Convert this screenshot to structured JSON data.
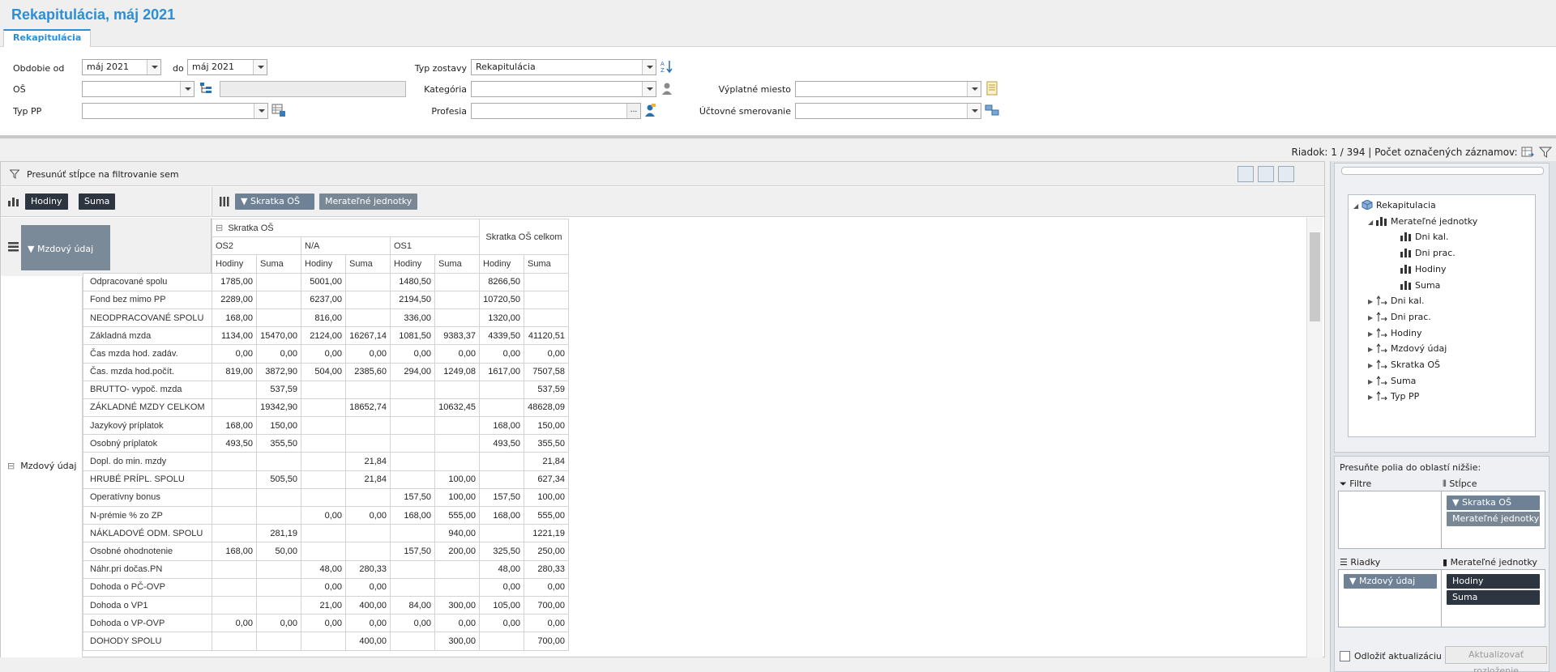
{
  "window": {
    "title": "Rekapitulácia, máj 2021",
    "tab": "Rekapitulácia"
  },
  "filters": {
    "obdobie_od_label": "Obdobie od",
    "obdobie_od_value": "máj 2021",
    "do_label": "do",
    "do_value": "máj 2021",
    "os_label": "OŠ",
    "os_value": "",
    "typpp_label": "Typ PP",
    "typpp_value": "",
    "typ_zostavy_label": "Typ zostavy",
    "typ_zostavy_value": "Rekapitulácia",
    "kategoria_label": "Kategória",
    "kategoria_value": "",
    "profesia_label": "Profesia",
    "profesia_value": "",
    "vyplatne_miesto_label": "Výplatné miesto",
    "vyplatne_miesto_value": "",
    "uctovne_label": "Účtovné smerovanie",
    "uctovne_value": ""
  },
  "status": {
    "text": "Riadok: 1 / 394 | Počet označených záznamov: 1"
  },
  "grid": {
    "filter_hint": "Presunúť stĺpce na filtrovanie sem",
    "data_chips": [
      "Hodiny",
      "Suma"
    ],
    "column_chips": [
      "Skratka OŠ",
      "Merateľné jednotky"
    ],
    "row_chip": "Mzdový údaj",
    "col_group_title": "Skratka OŠ",
    "col_groups": [
      "OS2",
      "N/A",
      "OS1"
    ],
    "total_header": "Skratka OŠ celkom",
    "measure_hodiny": "Hodiny",
    "measure_suma": "Suma",
    "row_group_label": "Mzdový údaj",
    "rows": [
      {
        "label": "Odpracované spolu",
        "v": [
          "1785,00",
          "",
          "5001,00",
          "",
          "1480,50",
          "",
          "8266,50",
          ""
        ]
      },
      {
        "label": "Fond bez mimo PP",
        "v": [
          "2289,00",
          "",
          "6237,00",
          "",
          "2194,50",
          "",
          "10720,50",
          ""
        ]
      },
      {
        "label": "NEODPRACOVANÉ SPOLU",
        "v": [
          "168,00",
          "",
          "816,00",
          "",
          "336,00",
          "",
          "1320,00",
          ""
        ]
      },
      {
        "label": "Základná mzda",
        "v": [
          "1134,00",
          "15470,00",
          "2124,00",
          "16267,14",
          "1081,50",
          "9383,37",
          "4339,50",
          "41120,51"
        ]
      },
      {
        "label": "Čas mzda hod. zadáv.",
        "v": [
          "0,00",
          "0,00",
          "0,00",
          "0,00",
          "0,00",
          "0,00",
          "0,00",
          "0,00"
        ]
      },
      {
        "label": "Čas. mzda hod.počít.",
        "v": [
          "819,00",
          "3872,90",
          "504,00",
          "2385,60",
          "294,00",
          "1249,08",
          "1617,00",
          "7507,58"
        ]
      },
      {
        "label": "BRUTTO- vypoč. mzda",
        "v": [
          "",
          "537,59",
          "",
          "",
          "",
          "",
          "",
          "537,59"
        ]
      },
      {
        "label": "ZÁKLADNÉ MZDY CELKOM",
        "v": [
          "",
          "19342,90",
          "",
          "18652,74",
          "",
          "10632,45",
          "",
          "48628,09"
        ]
      },
      {
        "label": "Jazykový príplatok",
        "v": [
          "168,00",
          "150,00",
          "",
          "",
          "",
          "",
          "168,00",
          "150,00"
        ]
      },
      {
        "label": "Osobný príplatok",
        "v": [
          "493,50",
          "355,50",
          "",
          "",
          "",
          "",
          "493,50",
          "355,50"
        ]
      },
      {
        "label": "Dopl. do min. mzdy",
        "v": [
          "",
          "",
          "",
          "21,84",
          "",
          "",
          "",
          "21,84"
        ]
      },
      {
        "label": "HRUBÉ PRÍPL. SPOLU",
        "v": [
          "",
          "505,50",
          "",
          "21,84",
          "",
          "100,00",
          "",
          "627,34"
        ]
      },
      {
        "label": "Operatívny bonus",
        "v": [
          "",
          "",
          "",
          "",
          "157,50",
          "100,00",
          "157,50",
          "100,00"
        ]
      },
      {
        "label": "N-prémie % zo ZP",
        "v": [
          "",
          "",
          "0,00",
          "0,00",
          "168,00",
          "555,00",
          "168,00",
          "555,00"
        ]
      },
      {
        "label": "NÁKLADOVÉ ODM. SPOLU",
        "v": [
          "",
          "281,19",
          "",
          "",
          "",
          "940,00",
          "",
          "1221,19"
        ]
      },
      {
        "label": "Osobné ohodnotenie",
        "v": [
          "168,00",
          "50,00",
          "",
          "",
          "157,50",
          "200,00",
          "325,50",
          "250,00"
        ]
      },
      {
        "label": "Náhr.pri dočas.PN",
        "v": [
          "",
          "",
          "48,00",
          "280,33",
          "",
          "",
          "48,00",
          "280,33"
        ]
      },
      {
        "label": "Dohoda o PČ-OVP",
        "v": [
          "",
          "",
          "0,00",
          "0,00",
          "",
          "",
          "0,00",
          "0,00"
        ]
      },
      {
        "label": "Dohoda o VP1",
        "v": [
          "",
          "",
          "21,00",
          "400,00",
          "84,00",
          "300,00",
          "105,00",
          "700,00"
        ]
      },
      {
        "label": "Dohoda o VP-OVP",
        "v": [
          "0,00",
          "0,00",
          "0,00",
          "0,00",
          "0,00",
          "0,00",
          "0,00",
          "0,00"
        ]
      },
      {
        "label": "DOHODY SPOLU",
        "v": [
          "",
          "",
          "",
          "400,00",
          "",
          "300,00",
          "",
          "700,00"
        ]
      }
    ]
  },
  "field_list": {
    "tree": [
      {
        "label": "Rekapitulacia",
        "level": 0,
        "expanded": true,
        "kind": "cube"
      },
      {
        "label": "Merateľné jednotky",
        "level": 1,
        "expanded": true,
        "kind": "measure"
      },
      {
        "label": "Dni kal.",
        "level": 2,
        "kind": "measure"
      },
      {
        "label": "Dni prac.",
        "level": 2,
        "kind": "measure"
      },
      {
        "label": "Hodiny",
        "level": 2,
        "kind": "measure"
      },
      {
        "label": "Suma",
        "level": 2,
        "kind": "measure"
      },
      {
        "label": "Dni kal.",
        "level": 1,
        "expanded": false,
        "kind": "dimension"
      },
      {
        "label": "Dni prac.",
        "level": 1,
        "expanded": false,
        "kind": "dimension"
      },
      {
        "label": "Hodiny",
        "level": 1,
        "expanded": false,
        "kind": "dimension"
      },
      {
        "label": "Mzdový údaj",
        "level": 1,
        "expanded": false,
        "kind": "dimension"
      },
      {
        "label": "Skratka OŠ",
        "level": 1,
        "expanded": false,
        "kind": "dimension"
      },
      {
        "label": "Suma",
        "level": 1,
        "expanded": false,
        "kind": "dimension"
      },
      {
        "label": "Typ PP",
        "level": 1,
        "expanded": false,
        "kind": "dimension"
      }
    ],
    "hint": "Presuňte polia do oblastí nižšie:",
    "zone_filter": "Filtre",
    "zone_columns": "Stĺpce",
    "zone_rows": "Riadky",
    "zone_measures": "Merateľné jednotky",
    "columns_items": [
      "Skratka OŠ",
      "Merateľné jednotky"
    ],
    "rows_items": [
      "Mzdový údaj"
    ],
    "measures_items": [
      "Hodiny",
      "Suma"
    ],
    "defer_label": "Odložiť aktualizáciu",
    "update_button": "Aktualizovať rozloženie"
  }
}
